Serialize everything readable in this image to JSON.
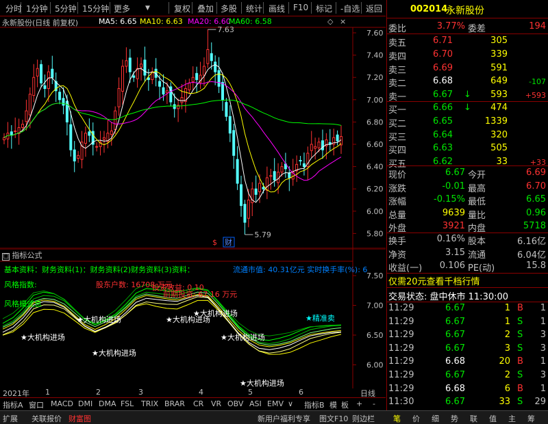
{
  "toolbar": {
    "items": [
      "分时",
      "1分钟",
      "5分钟",
      "15分钟",
      "更多",
      "复权",
      "叠加",
      "多股",
      "统计",
      "画线",
      "F10",
      "标记",
      "-自选",
      "返回"
    ]
  },
  "chart": {
    "title": "永新股份(日线 前复权)",
    "ma": [
      {
        "label": "MA5: 6.65",
        "color": "#ffffff"
      },
      {
        "label": "MA10: 6.63",
        "color": "#ffff00"
      },
      {
        "label": "MA20: 6.60",
        "color": "#ff00ff"
      },
      {
        "label": "MA60: 6.58",
        "color": "#00ff00"
      }
    ],
    "price_ticks": [
      "7.60",
      "7.40",
      "7.20",
      "7.00",
      "6.80",
      "6.60",
      "6.40",
      "6.20",
      "6.00",
      "5.80"
    ],
    "high_label": "7.63",
    "low_label": "5.79",
    "mark_dollar": "$",
    "mark_cai": "财"
  },
  "indicator": {
    "title": "指标公式",
    "ticks": [
      "7.50",
      "7.00",
      "6.50",
      "6.00"
    ],
    "info_lines": [
      {
        "text": "基本资料：财务资料(1)：财务资料(2)财务资料(3)资料：",
        "color": "#00ff00"
      },
      {
        "text": "流通市值: 40.31亿元 实时换手率(%): 6",
        "color": "#0080ff"
      },
      {
        "text": "股东户数: 16708 万元",
        "color": "#ff3232"
      },
      {
        "text": "投资收益: 0.10",
        "color": "#ff3232"
      },
      {
        "text": "前期投资: 67.16 万元",
        "color": "#ff3232"
      }
    ],
    "labels": [
      {
        "text": "★大机构进场",
        "color": "#ffffff"
      },
      {
        "text": "★大机构进场",
        "color": "#ffffff"
      },
      {
        "text": "★大机构进场",
        "color": "#ffffff"
      },
      {
        "text": "★大机构进场",
        "color": "#ffffff"
      },
      {
        "text": "★大机构进场",
        "color": "#ffffff"
      },
      {
        "text": "★大机构进场",
        "color": "#ffffff"
      },
      {
        "text": "★大机构进场",
        "color": "#ffffff"
      },
      {
        "text": "★精准卖",
        "color": "#00ffff"
      }
    ],
    "row_label_1": "风格指数:",
    "row_label_2": "风格模式息"
  },
  "time_axis": {
    "year": "2021年",
    "marks": [
      "1",
      "2",
      "3",
      "4",
      "5",
      "6"
    ],
    "right": "日线"
  },
  "tabs": {
    "items": [
      "指标A",
      "窗口",
      "MACD",
      "DMI",
      "DMA",
      "FSL",
      "TRIX",
      "BRAR",
      "CR",
      "VR",
      "OBV",
      "ASI",
      "EMV",
      "∨",
      "指标B",
      "模",
      "板",
      "+",
      "-"
    ]
  },
  "status": {
    "left": [
      "扩展",
      "关联报价",
      "财富图"
    ],
    "middle": [
      "新用户福利专享",
      "图文F10",
      "则边栏"
    ],
    "right": [
      "笔",
      "价",
      "细",
      "势",
      "联",
      "值",
      "主",
      "筹"
    ]
  },
  "panel": {
    "code": "002014",
    "name": "永新股份",
    "weibi_label": "委比",
    "weibi": "3.77%",
    "weicha_label": "委差",
    "weicha": "194",
    "asks": [
      {
        "label": "卖五",
        "price": "6.71",
        "vol": "305",
        "chg": ""
      },
      {
        "label": "卖四",
        "price": "6.70",
        "vol": "339",
        "chg": ""
      },
      {
        "label": "卖三",
        "price": "6.69",
        "vol": "591",
        "chg": ""
      },
      {
        "label": "卖二",
        "price": "6.68",
        "vol": "649",
        "chg": "-107"
      },
      {
        "label": "卖一",
        "price": "6.67",
        "vol": "593",
        "chg": "+593"
      }
    ],
    "bids": [
      {
        "label": "买一",
        "price": "6.66",
        "vol": "474",
        "chg": ""
      },
      {
        "label": "买二",
        "price": "6.65",
        "vol": "1339",
        "chg": ""
      },
      {
        "label": "买三",
        "price": "6.64",
        "vol": "320",
        "chg": ""
      },
      {
        "label": "买四",
        "price": "6.63",
        "vol": "505",
        "chg": ""
      },
      {
        "label": "买五",
        "price": "6.62",
        "vol": "33",
        "chg": "+33"
      }
    ],
    "stats": [
      {
        "l1": "现价",
        "v1": "6.67",
        "c1": "green",
        "l2": "今开",
        "v2": "6.69",
        "c2": "red"
      },
      {
        "l1": "涨跌",
        "v1": "-0.01",
        "c1": "green",
        "l2": "最高",
        "v2": "6.70",
        "c2": "red"
      },
      {
        "l1": "涨幅",
        "v1": "-0.15%",
        "c1": "green",
        "l2": "最低",
        "v2": "6.65",
        "c2": "green"
      },
      {
        "l1": "总量",
        "v1": "9639",
        "c1": "yellow",
        "l2": "量比",
        "v2": "0.96",
        "c2": "green"
      },
      {
        "l1": "外盘",
        "v1": "3921",
        "c1": "red",
        "l2": "内盘",
        "v2": "5718",
        "c2": "green"
      }
    ],
    "stats2": [
      {
        "l1": "换手",
        "v1": "0.16%",
        "l2": "股本",
        "v2": "6.16亿"
      },
      {
        "l1": "净资",
        "v1": "3.15",
        "l2": "流通",
        "v2": "6.04亿"
      },
      {
        "l1": "收益(一)",
        "v1": "0.106",
        "l2": "PE(动)",
        "v2": "15.8"
      }
    ],
    "promo": "仅需20元查看千档行情",
    "trade_status": "交易状态: 盘中休市 11:30:00",
    "ticks": [
      {
        "t": "11:29",
        "p": "6.67",
        "pc": "green",
        "v": "1",
        "s": "B",
        "sc": "red",
        "n": "1"
      },
      {
        "t": "11:29",
        "p": "6.67",
        "pc": "green",
        "v": "1",
        "s": "S",
        "sc": "green",
        "n": "1"
      },
      {
        "t": "11:29",
        "p": "6.67",
        "pc": "green",
        "v": "2",
        "s": "S",
        "sc": "green",
        "n": "3"
      },
      {
        "t": "11:29",
        "p": "6.67",
        "pc": "green",
        "v": "3",
        "s": "S",
        "sc": "green",
        "n": "3"
      },
      {
        "t": "11:29",
        "p": "6.68",
        "pc": "white",
        "v": "20",
        "s": "B",
        "sc": "red",
        "n": "1"
      },
      {
        "t": "11:29",
        "p": "6.67",
        "pc": "green",
        "v": "2",
        "s": "S",
        "sc": "green",
        "n": "3"
      },
      {
        "t": "11:29",
        "p": "6.68",
        "pc": "white",
        "v": "6",
        "s": "B",
        "sc": "red",
        "n": "1"
      },
      {
        "t": "11:30",
        "p": "6.67",
        "pc": "green",
        "v": "33",
        "s": "S",
        "sc": "green",
        "n": "29"
      }
    ]
  }
}
